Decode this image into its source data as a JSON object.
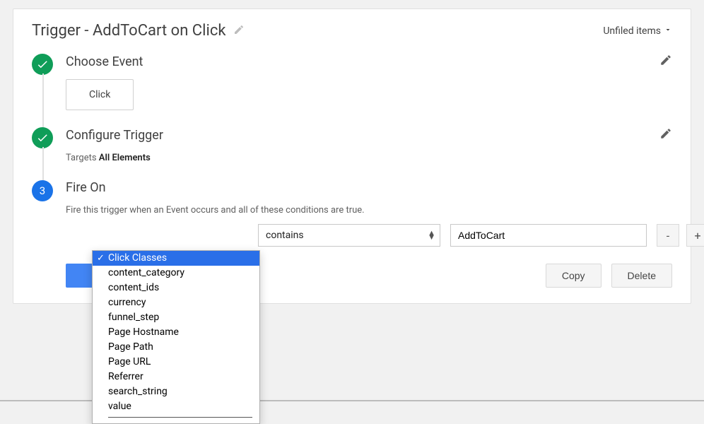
{
  "header": {
    "title": "Trigger - AddToCart on Click",
    "menu": "Unfiled items"
  },
  "steps": {
    "choose_event": {
      "title": "Choose Event",
      "chip": "Click"
    },
    "configure": {
      "title": "Configure Trigger",
      "targets_prefix": "Targets ",
      "targets_value": "All Elements"
    },
    "fire_on": {
      "number": "3",
      "title": "Fire On",
      "help": "Fire this trigger when an Event occurs and all of these conditions are true.",
      "operator": "contains",
      "value": "AddToCart",
      "minus": "-",
      "plus": "+"
    }
  },
  "actions": {
    "copy": "Copy",
    "delete": "Delete"
  },
  "dropdown": {
    "items": [
      {
        "label": "Click Classes",
        "selected": true
      },
      {
        "label": "content_category",
        "selected": false
      },
      {
        "label": "content_ids",
        "selected": false
      },
      {
        "label": "currency",
        "selected": false
      },
      {
        "label": "funnel_step",
        "selected": false
      },
      {
        "label": "Page Hostname",
        "selected": false
      },
      {
        "label": "Page Path",
        "selected": false
      },
      {
        "label": "Page URL",
        "selected": false
      },
      {
        "label": "Referrer",
        "selected": false
      },
      {
        "label": "search_string",
        "selected": false
      },
      {
        "label": "value",
        "selected": false
      }
    ]
  }
}
